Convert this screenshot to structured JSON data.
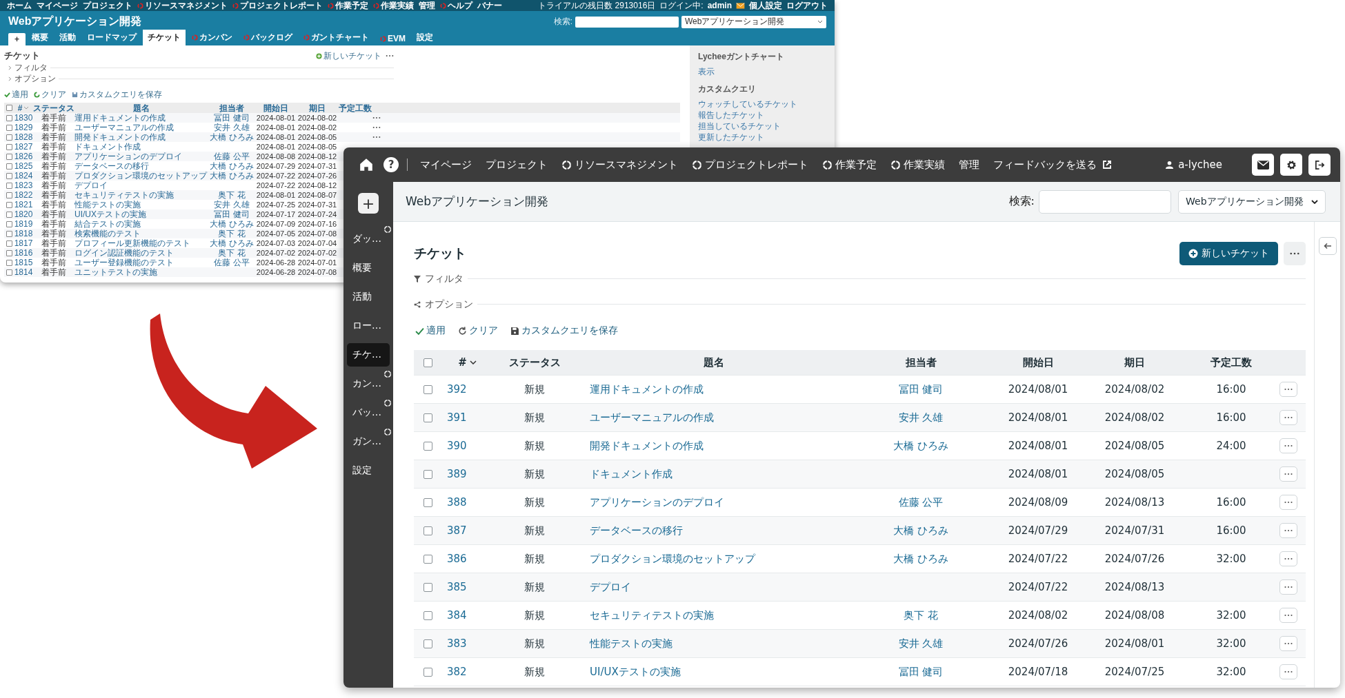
{
  "old_screen": {
    "top_menu": [
      {
        "label": "ホーム",
        "plugin": false
      },
      {
        "label": "マイページ",
        "plugin": false
      },
      {
        "label": "プロジェクト",
        "plugin": false
      },
      {
        "label": "リソースマネジメント",
        "plugin": true
      },
      {
        "label": "プロジェクトレポート",
        "plugin": true
      },
      {
        "label": "作業予定",
        "plugin": true
      },
      {
        "label": "作業実績",
        "plugin": true
      },
      {
        "label": "管理",
        "plugin": false
      },
      {
        "label": "ヘルプ",
        "plugin": true
      },
      {
        "label": "バナー",
        "plugin": false
      }
    ],
    "trial": "トライアルの残日数 2913016日",
    "login_label": "ログイン中:",
    "login_user": "admin",
    "account_links": [
      "個人設定",
      "ログアウト"
    ],
    "project_title": "Webアプリケーション開発",
    "search_label": "検索:",
    "project_select": "Webアプリケーション開発",
    "tabs": [
      {
        "kind": "add",
        "label": "+",
        "selected": false,
        "plugin": false
      },
      {
        "kind": "tab",
        "label": "概要",
        "selected": false,
        "plugin": false
      },
      {
        "kind": "tab",
        "label": "活動",
        "selected": false,
        "plugin": false
      },
      {
        "kind": "tab",
        "label": "ロードマップ",
        "selected": false,
        "plugin": false
      },
      {
        "kind": "tab",
        "label": "チケット",
        "selected": true,
        "plugin": false
      },
      {
        "kind": "tab",
        "label": "カンバン",
        "selected": false,
        "plugin": true
      },
      {
        "kind": "tab",
        "label": "バックログ",
        "selected": false,
        "plugin": true
      },
      {
        "kind": "tab",
        "label": "ガントチャート",
        "selected": false,
        "plugin": true
      },
      {
        "kind": "tab",
        "label": "EVM",
        "selected": false,
        "plugin": true
      },
      {
        "kind": "tab",
        "label": "設定",
        "selected": false,
        "plugin": false
      }
    ],
    "page_title": "チケット",
    "new_button": "新しいチケット",
    "sections": [
      "フィルタ",
      "オプション"
    ],
    "actions": [
      "適用",
      "クリア",
      "カスタムクエリを保存"
    ],
    "select_all_checked": false,
    "columns": [
      "#",
      "ステータス",
      "題名",
      "担当者",
      "開始日",
      "期日",
      "予定工数"
    ],
    "rows": [
      {
        "checked": false,
        "id": "1830",
        "status": "着手前",
        "subject": "運用ドキュメントの作成",
        "assignee": "冨田 健司",
        "start": "2024-08-01",
        "due": "2024-08-02",
        "menu": true
      },
      {
        "checked": false,
        "id": "1829",
        "status": "着手前",
        "subject": "ユーザーマニュアルの作成",
        "assignee": "安井 久雄",
        "start": "2024-08-01",
        "due": "2024-08-02",
        "menu": true
      },
      {
        "checked": false,
        "id": "1828",
        "status": "着手前",
        "subject": "開発ドキュメントの作成",
        "assignee": "大橋 ひろみ",
        "start": "2024-08-01",
        "due": "2024-08-05",
        "menu": true
      },
      {
        "checked": false,
        "id": "1827",
        "status": "着手前",
        "subject": "ドキュメント作成",
        "start": "2024-08-01",
        "due": "2024-08-05"
      },
      {
        "checked": false,
        "id": "1826",
        "status": "着手前",
        "subject": "アプリケーションのデプロイ",
        "assignee": "佐藤 公平",
        "start": "2024-08-08",
        "due": "2024-08-12"
      },
      {
        "checked": false,
        "id": "1825",
        "status": "着手前",
        "subject": "データベースの移行",
        "assignee": "大橋 ひろみ",
        "start": "2024-07-29",
        "due": "2024-07-31"
      },
      {
        "checked": false,
        "id": "1824",
        "status": "着手前",
        "subject": "プロダクション環境のセットアップ",
        "assignee": "大橋 ひろみ",
        "start": "2024-07-22",
        "due": "2024-07-26"
      },
      {
        "checked": false,
        "id": "1823",
        "status": "着手前",
        "subject": "デプロイ",
        "start": "2024-07-22",
        "due": "2024-08-12"
      },
      {
        "checked": false,
        "id": "1822",
        "status": "着手前",
        "subject": "セキュリティテストの実施",
        "assignee": "奥下 花",
        "start": "2024-08-01",
        "due": "2024-08-07"
      },
      {
        "checked": false,
        "id": "1821",
        "status": "着手前",
        "subject": "性能テストの実施",
        "assignee": "安井 久雄",
        "start": "2024-07-25",
        "due": "2024-07-31"
      },
      {
        "checked": false,
        "id": "1820",
        "status": "着手前",
        "subject": "UI/UXテストの実施",
        "assignee": "冨田 健司",
        "start": "2024-07-17",
        "due": "2024-07-24"
      },
      {
        "checked": false,
        "id": "1819",
        "status": "着手前",
        "subject": "結合テストの実施",
        "assignee": "大橋 ひろみ",
        "start": "2024-07-09",
        "due": "2024-07-16"
      },
      {
        "checked": false,
        "id": "1818",
        "status": "着手前",
        "subject": "検索機能のテスト",
        "assignee": "奥下 花",
        "start": "2024-07-05",
        "due": "2024-07-08"
      },
      {
        "checked": false,
        "id": "1817",
        "status": "着手前",
        "subject": "プロフィール更新機能のテスト",
        "assignee": "大橋 ひろみ",
        "start": "2024-07-03",
        "due": "2024-07-04"
      },
      {
        "checked": false,
        "id": "1816",
        "status": "着手前",
        "subject": "ログイン認証機能のテスト",
        "assignee": "奥下 花",
        "start": "2024-07-02",
        "due": "2024-07-02"
      },
      {
        "checked": false,
        "id": "1815",
        "status": "着手前",
        "subject": "ユーザー登録機能のテスト",
        "assignee": "佐藤 公平",
        "start": "2024-06-28",
        "due": "2024-07-01"
      },
      {
        "checked": false,
        "id": "1814",
        "status": "着手前",
        "subject": "ユニットテストの実施",
        "start": "2024-06-28",
        "due": "2024-07-08"
      }
    ],
    "sidebar": {
      "gantt_title": "Lycheeガントチャート",
      "gantt_link": "表示",
      "query_title": "カスタムクエリ",
      "queries": [
        "ウォッチしているチケット",
        "報告したチケット",
        "担当しているチケット",
        "更新したチケット"
      ]
    }
  },
  "new_screen": {
    "help_button": "?",
    "nav": [
      {
        "kind": "plain",
        "label": "マイページ"
      },
      {
        "kind": "plain",
        "label": "プロジェクト"
      },
      {
        "kind": "plugin",
        "label": "リソースマネジメント"
      },
      {
        "kind": "plugin",
        "label": "プロジェクトレポート"
      },
      {
        "kind": "plugin",
        "label": "作業予定"
      },
      {
        "kind": "plugin",
        "label": "作業実績"
      },
      {
        "kind": "plain",
        "label": "管理"
      },
      {
        "kind": "external",
        "label": "フィードバックを送る"
      }
    ],
    "user": "a-lychee",
    "add_button": "+",
    "side_items": [
      {
        "label": "ダッ…",
        "selected": false,
        "plugin": true
      },
      {
        "label": "概要",
        "selected": false,
        "plugin": false
      },
      {
        "label": "活動",
        "selected": false,
        "plugin": false
      },
      {
        "label": "ロー…",
        "selected": false,
        "plugin": false
      },
      {
        "label": "チケ…",
        "selected": true,
        "plugin": false
      },
      {
        "label": "カン…",
        "selected": false,
        "plugin": true
      },
      {
        "label": "バッ…",
        "selected": false,
        "plugin": true
      },
      {
        "label": "ガン…",
        "selected": false,
        "plugin": true
      },
      {
        "label": "設定",
        "selected": false,
        "plugin": false
      }
    ],
    "project_title": "Webアプリケーション開発",
    "search_label": "検索:",
    "project_select": "Webアプリケーション開発",
    "page_title": "チケット",
    "new_button": "新しいチケット",
    "sections": [
      "フィルタ",
      "オプション"
    ],
    "actions": [
      "適用",
      "クリア",
      "カスタムクエリを保存"
    ],
    "select_all_checked": false,
    "columns": [
      "#",
      "ステータス",
      "題名",
      "担当者",
      "開始日",
      "期日",
      "予定工数"
    ],
    "rows": [
      {
        "checked": false,
        "id": "392",
        "status": "新規",
        "subject": "運用ドキュメントの作成",
        "assignee": "冨田 健司",
        "start": "2024/08/01",
        "due": "2024/08/02",
        "estimate": "16:00"
      },
      {
        "checked": false,
        "id": "391",
        "status": "新規",
        "subject": "ユーザーマニュアルの作成",
        "assignee": "安井 久雄",
        "start": "2024/08/01",
        "due": "2024/08/02",
        "estimate": "16:00"
      },
      {
        "checked": false,
        "id": "390",
        "status": "新規",
        "subject": "開発ドキュメントの作成",
        "assignee": "大橋 ひろみ",
        "start": "2024/08/01",
        "due": "2024/08/05",
        "estimate": "24:00"
      },
      {
        "checked": false,
        "id": "389",
        "status": "新規",
        "subject": "ドキュメント作成",
        "start": "2024/08/01",
        "due": "2024/08/05"
      },
      {
        "checked": false,
        "id": "388",
        "status": "新規",
        "subject": "アプリケーションのデプロイ",
        "assignee": "佐藤 公平",
        "start": "2024/08/09",
        "due": "2024/08/13",
        "estimate": "16:00"
      },
      {
        "checked": false,
        "id": "387",
        "status": "新規",
        "subject": "データベースの移行",
        "assignee": "大橋 ひろみ",
        "start": "2024/07/29",
        "due": "2024/07/31",
        "estimate": "16:00"
      },
      {
        "checked": false,
        "id": "386",
        "status": "新規",
        "subject": "プロダクション環境のセットアップ",
        "assignee": "大橋 ひろみ",
        "start": "2024/07/22",
        "due": "2024/07/26",
        "estimate": "32:00"
      },
      {
        "checked": false,
        "id": "385",
        "status": "新規",
        "subject": "デプロイ",
        "start": "2024/07/22",
        "due": "2024/08/13"
      },
      {
        "checked": false,
        "id": "384",
        "status": "新規",
        "subject": "セキュリティテストの実施",
        "assignee": "奥下 花",
        "start": "2024/08/02",
        "due": "2024/08/08",
        "estimate": "32:00"
      },
      {
        "checked": false,
        "id": "383",
        "status": "新規",
        "subject": "性能テストの実施",
        "assignee": "安井 久雄",
        "start": "2024/07/26",
        "due": "2024/08/01",
        "estimate": "32:00"
      },
      {
        "checked": false,
        "id": "382",
        "status": "新規",
        "subject": "UI/UXテストの実施",
        "assignee": "冨田 健司",
        "start": "2024/07/18",
        "due": "2024/07/25",
        "estimate": "32:00"
      }
    ]
  }
}
